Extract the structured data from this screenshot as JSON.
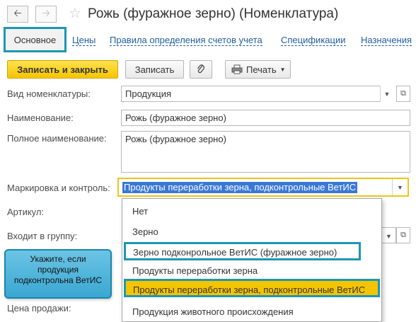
{
  "window": {
    "title": "Рожь (фуражное зерно) (Номенклатура)",
    "nav_back_icon": "arrow-left-icon",
    "nav_forward_icon": "arrow-right-icon",
    "favorite_icon": "star-icon"
  },
  "tabs": {
    "active": "Основное",
    "links": [
      "Цены",
      "Правила определения счетов учета",
      "Спецификации",
      "Назначения"
    ]
  },
  "toolbar": {
    "save_close": "Записать и закрыть",
    "save": "Записать",
    "attach_icon": "paperclip-icon",
    "print": "Печать",
    "print_icon": "printer-icon"
  },
  "form": {
    "vid_label": "Вид номенклатуры:",
    "vid_value": "Продукция",
    "name_label": "Наименование:",
    "name_value": "Рожь (фуражное зерно)",
    "fullname_label": "Полное наименование:",
    "fullname_value": "Рожь (фуражное зерно)",
    "marking_label": "Маркировка и контроль:",
    "marking_value": "Продукты переработки зерна, подконтрольные ВетИС",
    "article_label": "Артикул:",
    "group_label": "Входит в группу:",
    "price_label": "Цена продажи:"
  },
  "dropdown": {
    "options": [
      "Нет",
      "Зерно",
      "Зерно подконрольное ВетИС (фуражное зерно)",
      "Продукты переработки зерна",
      "Продукты переработки зерна, подконтрольные ВетИС",
      "Продукция животного происхождения"
    ]
  },
  "tooltip": {
    "text": "Укажите, если продукция подконтрольна ВетИС"
  },
  "colors": {
    "accent_highlight": "#1c97b3",
    "primary_button": "#f5c400",
    "selection": "#3a78d8",
    "link": "#1f5d9c"
  }
}
